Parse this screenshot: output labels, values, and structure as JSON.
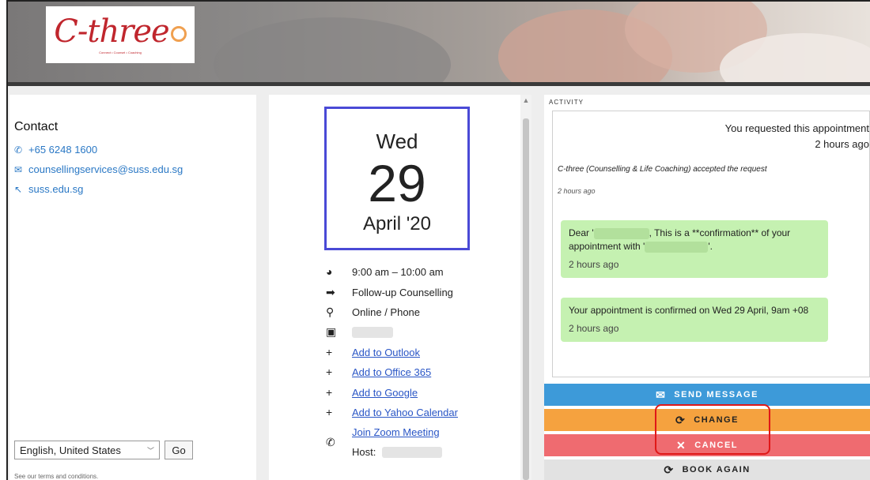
{
  "header": {
    "logo_text": "C-three",
    "logo_tagline": "Connect • Counsel • Coaching"
  },
  "contact": {
    "title": "Contact",
    "phone": "+65 6248 1600",
    "email": "counsellingservices@suss.edu.sg",
    "website": "suss.edu.sg",
    "language": "English, United States",
    "go_label": "Go",
    "terms": "See our terms and conditions."
  },
  "appointment": {
    "day": "Wed",
    "date": "29",
    "month_year": "April '20",
    "time": "9:00 am – 10:00 am",
    "service": "Follow-up Counselling",
    "location": "Online / Phone",
    "links": {
      "outlook": "Add to Outlook",
      "office365": "Add to Office 365",
      "google": "Add to Google",
      "yahoo": "Add to Yahoo Calendar",
      "zoom": "Join Zoom Meeting"
    },
    "host_label": "Host:"
  },
  "activity": {
    "label": "ACTIVITY",
    "requested_text": "You requested this appointment",
    "requested_time": "2 hours ago",
    "accepted_text": "C-three (Counselling & Life Coaching) accepted the request",
    "accepted_time": "2 hours ago",
    "messages": [
      {
        "part1": "Dear '",
        "part2": ", This is a **confirmation** of your appointment with '",
        "part3": "'.",
        "time": "2 hours ago"
      },
      {
        "text": "Your appointment is confirmed on Wed 29 April, 9am +08",
        "time": "2 hours ago"
      }
    ]
  },
  "actions": {
    "send": "SEND MESSAGE",
    "change": "CHANGE",
    "cancel": "CANCEL",
    "book_again": "BOOK AGAIN"
  },
  "colors": {
    "send": "#3d9ad9",
    "change": "#f5a23f",
    "cancel": "#ef6b70",
    "book_again": "#e2e2e2",
    "message_bubble": "#c5f1b1",
    "date_border": "#4a4ad6",
    "highlight": "#e01818"
  }
}
